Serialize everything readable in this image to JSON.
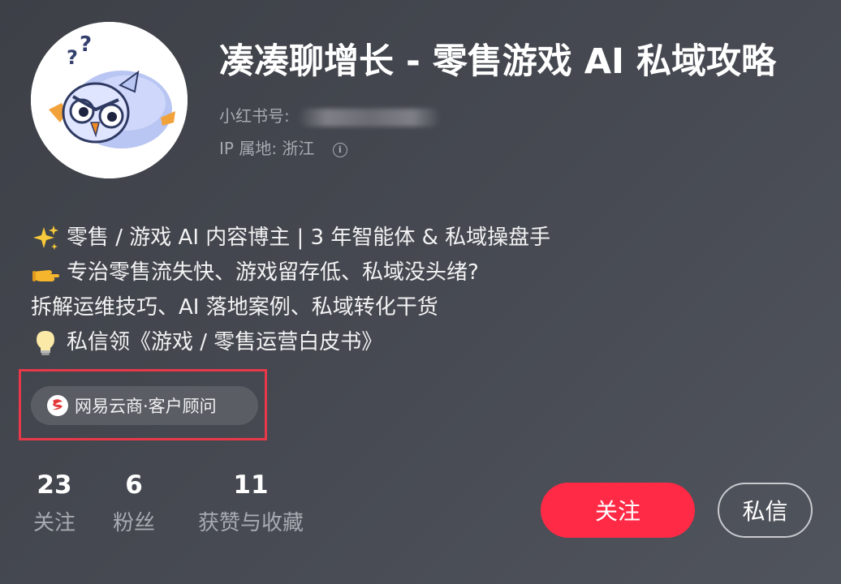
{
  "profile": {
    "name": "凑凑聊增长 - 零售游戏 AI 私域攻略",
    "id_label": "小红书号:",
    "ip_label": "IP 属地: 浙江",
    "avatar_icon": "owl-avatar-icon"
  },
  "bio": {
    "lines": [
      {
        "emoji": "sparkles-icon",
        "text": "零售 / 游戏 AI 内容博主 | 3 年智能体 & 私域操盘手"
      },
      {
        "emoji": "pointing-hand-icon",
        "text": "专治零售流失快、游戏留存低、私域没头绪?"
      },
      {
        "emoji": "",
        "text": "拆解运维技巧、AI 落地案例、私域转化干货"
      },
      {
        "emoji": "light-bulb-icon",
        "text": "私信领《游戏 / 零售运营白皮书》"
      }
    ]
  },
  "tag": {
    "label": "网易云商·客户顾问",
    "icon": "netease-logo-icon"
  },
  "stats": [
    {
      "count": "23",
      "label": "关注"
    },
    {
      "count": "6",
      "label": "粉丝"
    },
    {
      "count": "11",
      "label": "获赞与收藏"
    }
  ],
  "actions": {
    "follow_label": "关注",
    "message_label": "私信"
  },
  "colors": {
    "background": "#45484f",
    "follow_button": "#ff2a45",
    "highlight_box": "#e8384a",
    "secondary_text": "#a7aab0"
  }
}
